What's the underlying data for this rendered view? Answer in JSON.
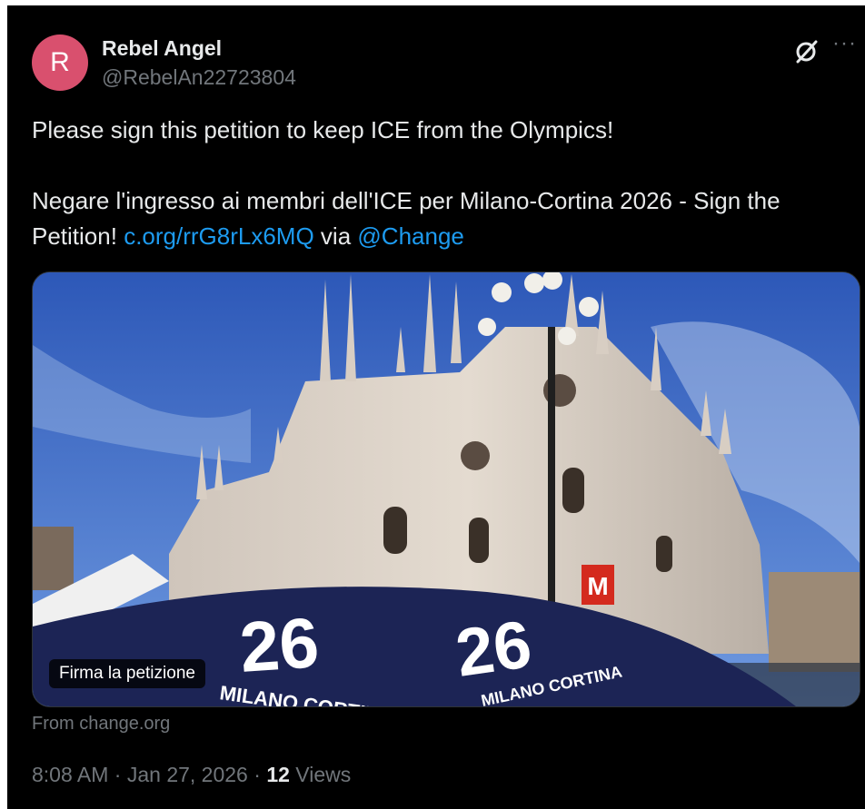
{
  "author": {
    "avatar_letter": "R",
    "display_name": "Rebel Angel",
    "handle": "@RebelAn22723804"
  },
  "header_icons": {
    "grok": "grok-slash-icon",
    "more": "···"
  },
  "tweet": {
    "line1": "Please sign this petition to keep ICE from the Olympics!",
    "line2_text": "Negare l'ingresso ai membri dell'ICE per Milano-Cortina 2026 - Sign the Petition!",
    "link": "c.org/rrG8rLx6MQ",
    "via": "via",
    "mention": "@Change"
  },
  "card": {
    "label": "Firma la petizione",
    "source": "From change.org",
    "image_text": {
      "logo1": "MILANO CORTINA",
      "logo2": "MILANO CORTINA",
      "metro": "M"
    }
  },
  "meta": {
    "time": "8:08 AM",
    "separator": "·",
    "date": "Jan 27, 2026",
    "views_count": "12",
    "views_label": "Views"
  },
  "colors": {
    "background": "#000000",
    "text": "#e7e9ea",
    "muted": "#71767b",
    "link": "#1d9bf0",
    "avatar": "#d9506e"
  }
}
